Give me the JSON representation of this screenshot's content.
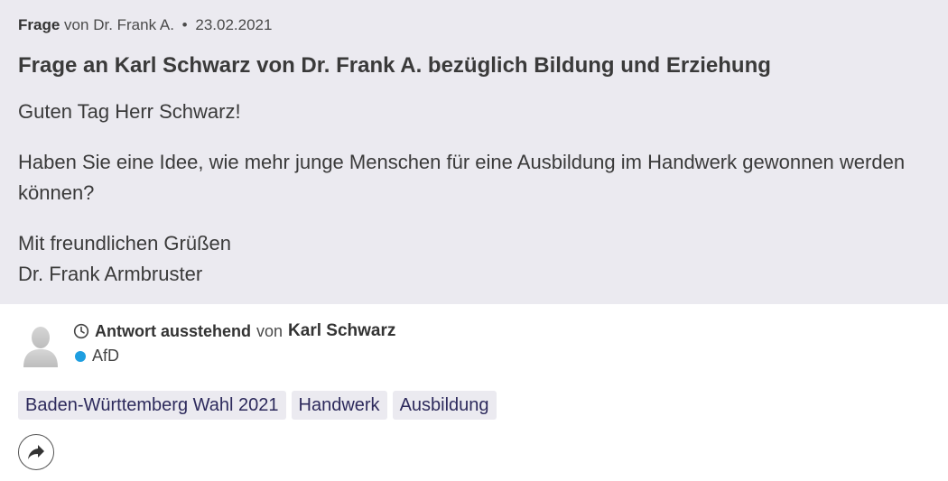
{
  "question": {
    "label": "Frage",
    "von": "von",
    "author": "Dr. Frank A.",
    "separator": "•",
    "date": "23.02.2021",
    "title": "Frage an Karl Schwarz von Dr. Frank A. bezüglich Bildung und Erziehung",
    "greeting": "Guten Tag Herr Schwarz!",
    "body": "Haben Sie eine Idee, wie mehr junge Menschen für eine Ausbildung im Handwerk gewonnen werden können?",
    "closing": "Mit freundlichen Grüßen",
    "signature": "Dr. Frank Armbruster"
  },
  "answer": {
    "status": "Antwort ausstehend",
    "von": "von",
    "politician": "Karl Schwarz",
    "party": "AfD",
    "party_color": "#1e9ee0"
  },
  "tags": [
    "Baden-Württemberg Wahl 2021",
    "Handwerk",
    "Ausbildung"
  ],
  "icons": {
    "avatar": "person-silhouette-icon",
    "status": "clock-icon",
    "share": "share-arrow-icon"
  }
}
